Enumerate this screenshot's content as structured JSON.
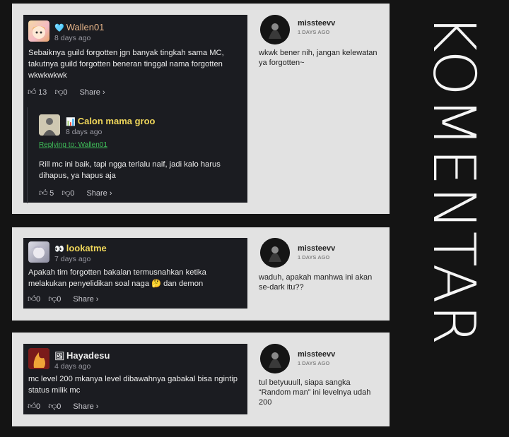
{
  "page_title": "KOMENTAR",
  "actions": {
    "share_label": "Share ›"
  },
  "comments": [
    {
      "user": "Wallen01",
      "user_icon": "🩵",
      "time": "8 days ago",
      "text": "Sebaiknya guild forgotten jgn banyak tingkah sama MC, takutnya guild forgotten beneran tinggal nama forgotten wkwkwkwk",
      "likes": "13",
      "dislikes": "0",
      "name_color": "#e9b68a",
      "reply": {
        "user": "Calon mama groo",
        "user_icon": "📊",
        "time": "8 days ago",
        "replying_to": "Replying to: Wallen01",
        "text": "Rill mc ini baik, tapi ngga terlalu naif, jadi kalo harus dihapus, ya hapus aja",
        "likes": "5",
        "dislikes": "0",
        "name_color": "#efd65a"
      },
      "response": {
        "user": "missteevv",
        "time": "1 DAYS AGO",
        "text": "wkwk bener nih, jangan kelewatan ya forgotten~"
      }
    },
    {
      "user": "lookatme",
      "user_icon": "👀",
      "time": "7 days ago",
      "text": "Apakah tim forgotten bakalan termusnahkan ketika melakukan penyelidikan soal naga 🤔 dan demon",
      "likes": "0",
      "dislikes": "0",
      "name_color": "#efd65a",
      "response": {
        "user": "missteevv",
        "time": "1 DAYS AGO",
        "text": "waduh, apakah manhwa ini akan se-dark itu??"
      }
    },
    {
      "user": "Hayadesu",
      "user_icon": "🖼",
      "time": "4 days ago",
      "text": "mc level 200 mkanya level dibawahnya gabakal bisa ngintip status milik mc",
      "likes": "0",
      "dislikes": "0",
      "name_color": "#ededed",
      "response": {
        "user": "missteevv",
        "time": "1 DAYS AGO",
        "text": "tul betyuuull, siapa sangka “Random man” ini levelnya udah 200"
      }
    }
  ]
}
